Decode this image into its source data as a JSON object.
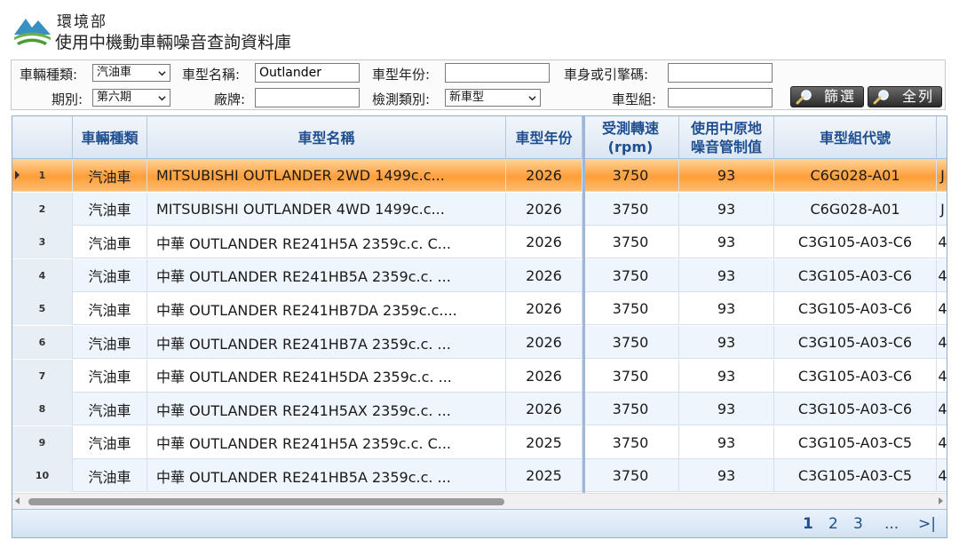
{
  "header": {
    "org_name": "環境部",
    "app_title": "使用中機動車輛噪音查詢資料庫"
  },
  "filters": {
    "vehicle_type_label": "車輛種類:",
    "vehicle_type_value": "汽油車",
    "model_name_label": "車型名稱:",
    "model_name_value": "Outlander",
    "model_year_label": "車型年份:",
    "model_year_value": "",
    "engine_code_label": "車身或引擎碼:",
    "engine_code_value": "",
    "period_label": "期別:",
    "period_value": "第六期",
    "brand_label": "廠牌:",
    "brand_value": "",
    "test_type_label": "檢測類別:",
    "test_type_value": "新車型",
    "model_group_label": "車型組:",
    "model_group_value": "",
    "filter_button": "篩選",
    "list_all_button": "全列"
  },
  "table": {
    "columns": [
      "車輛種類",
      "車型名稱",
      "車型年份",
      "受測轉速\n(rpm)",
      "使用中原地\n噪音管制值",
      "車型組代號"
    ],
    "rows": [
      {
        "idx": "1",
        "type": "汽油車",
        "name": "MITSUBISHI OUTLANDER 2WD 1499c.c...",
        "year": "2026",
        "rpm": "3750",
        "limit": "93",
        "group": "C6G028-A01",
        "extra": "J"
      },
      {
        "idx": "2",
        "type": "汽油車",
        "name": "MITSUBISHI OUTLANDER 4WD 1499c.c...",
        "year": "2026",
        "rpm": "3750",
        "limit": "93",
        "group": "C6G028-A01",
        "extra": "J"
      },
      {
        "idx": "3",
        "type": "汽油車",
        "name": "中華 OUTLANDER RE241H5A 2359c.c. C...",
        "year": "2026",
        "rpm": "3750",
        "limit": "93",
        "group": "C3G105-A03-C6",
        "extra": "4"
      },
      {
        "idx": "4",
        "type": "汽油車",
        "name": "中華 OUTLANDER RE241HB5A 2359c.c. ...",
        "year": "2026",
        "rpm": "3750",
        "limit": "93",
        "group": "C3G105-A03-C6",
        "extra": "4"
      },
      {
        "idx": "5",
        "type": "汽油車",
        "name": "中華 OUTLANDER RE241HB7DA 2359c.c....",
        "year": "2026",
        "rpm": "3750",
        "limit": "93",
        "group": "C3G105-A03-C6",
        "extra": "4"
      },
      {
        "idx": "6",
        "type": "汽油車",
        "name": "中華 OUTLANDER RE241HB7A 2359c.c. ...",
        "year": "2026",
        "rpm": "3750",
        "limit": "93",
        "group": "C3G105-A03-C6",
        "extra": "4"
      },
      {
        "idx": "7",
        "type": "汽油車",
        "name": "中華 OUTLANDER RE241H5DA 2359c.c. ...",
        "year": "2026",
        "rpm": "3750",
        "limit": "93",
        "group": "C3G105-A03-C6",
        "extra": "4"
      },
      {
        "idx": "8",
        "type": "汽油車",
        "name": "中華 OUTLANDER RE241H5AX 2359c.c. ...",
        "year": "2026",
        "rpm": "3750",
        "limit": "93",
        "group": "C3G105-A03-C6",
        "extra": "4"
      },
      {
        "idx": "9",
        "type": "汽油車",
        "name": "中華 OUTLANDER RE241H5A 2359c.c. C...",
        "year": "2025",
        "rpm": "3750",
        "limit": "93",
        "group": "C3G105-A03-C5",
        "extra": "4"
      },
      {
        "idx": "10",
        "type": "汽油車",
        "name": "中華 OUTLANDER RE241HB5A 2359c.c. ...",
        "year": "2025",
        "rpm": "3750",
        "limit": "93",
        "group": "C3G105-A03-C5",
        "extra": "4"
      }
    ]
  },
  "pager": {
    "pages": [
      "1",
      "2",
      "3",
      "..."
    ],
    "last": ">|"
  },
  "colors": {
    "accent": "#1f4f8f",
    "selected_row": "#ff9e3a",
    "alt_row": "#eef5fc"
  },
  "icons": {
    "logo": "moenv-logo",
    "magnifier": "magnifier-icon"
  }
}
